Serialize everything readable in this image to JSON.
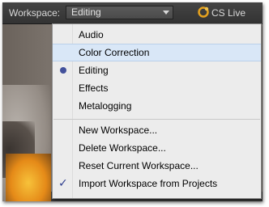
{
  "toolbar": {
    "workspace_label": "Workspace:",
    "workspace_value": "Editing",
    "cs_live": "CS Live"
  },
  "menu": {
    "items": [
      {
        "label": "Audio"
      },
      {
        "label": "Color Correction",
        "highlighted": true
      },
      {
        "label": "Editing",
        "selected": true
      },
      {
        "label": "Effects"
      },
      {
        "label": "Metalogging"
      }
    ],
    "actions": [
      {
        "label": "New Workspace..."
      },
      {
        "label": "Delete Workspace..."
      },
      {
        "label": "Reset Current Workspace..."
      },
      {
        "label": "Import Workspace from Projects",
        "checked": true
      }
    ]
  },
  "colors": {
    "highlight": "#d9e7f7",
    "menu_bg": "#ececec",
    "radio": "#43519b",
    "check": "#2f3e8f"
  }
}
